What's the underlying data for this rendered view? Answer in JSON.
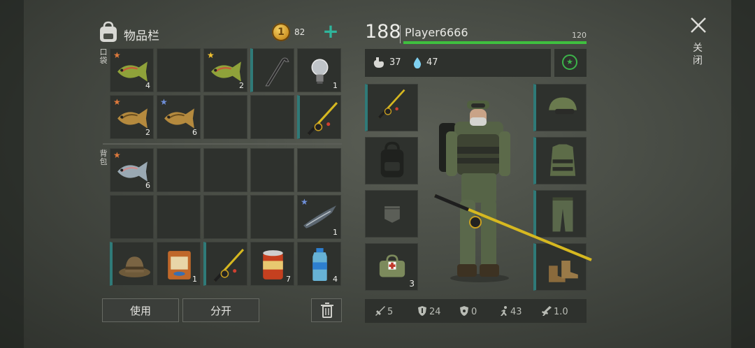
{
  "inventory": {
    "title": "物品栏",
    "coins": "82",
    "pocket_label": "口袋",
    "backpack_label": "背包",
    "pockets": [
      {
        "icon": "perch-fish-icon",
        "count": "4",
        "star": "orange"
      },
      {
        "icon": "empty",
        "count": ""
      },
      {
        "icon": "perch-fish-icon",
        "count": "2",
        "star": "gold"
      },
      {
        "icon": "crowbar-icon",
        "count": "",
        "accent": true
      },
      {
        "icon": "lightbulb-icon",
        "count": "1"
      },
      {
        "icon": "carp-fish-icon",
        "count": "2",
        "star": "orange"
      },
      {
        "icon": "carp-fish-icon",
        "count": "6",
        "star": "blue"
      },
      {
        "icon": "empty",
        "count": ""
      },
      {
        "icon": "empty",
        "count": ""
      },
      {
        "icon": "fishing-rod-icon",
        "count": "",
        "accent": true
      }
    ],
    "backpack": [
      {
        "icon": "salmon-fish-icon",
        "count": "6",
        "star": "orange"
      },
      {
        "icon": "empty",
        "count": ""
      },
      {
        "icon": "empty",
        "count": ""
      },
      {
        "icon": "empty",
        "count": ""
      },
      {
        "icon": "empty",
        "count": ""
      },
      {
        "icon": "empty",
        "count": ""
      },
      {
        "icon": "empty",
        "count": ""
      },
      {
        "icon": "empty",
        "count": ""
      },
      {
        "icon": "empty",
        "count": ""
      },
      {
        "icon": "sturgeon-fish-icon",
        "count": "1",
        "star": "blue"
      },
      {
        "icon": "bucket-hat-icon",
        "count": "",
        "accent": true
      },
      {
        "icon": "bait-bag-icon",
        "count": "1"
      },
      {
        "icon": "fishing-rod-icon",
        "count": "",
        "accent": true
      },
      {
        "icon": "canned-food-icon",
        "count": "7"
      },
      {
        "icon": "water-bottle-icon",
        "count": "4"
      }
    ],
    "use_label": "使用",
    "split_label": "分开"
  },
  "player": {
    "level": "188",
    "name": "Player6666",
    "xp_max": "120",
    "xp_fraction": 1.0,
    "hunger": "37",
    "thirst": "47"
  },
  "equipment": {
    "left": [
      {
        "icon": "fishing-rod-icon",
        "count": "",
        "accent": true
      },
      {
        "icon": "backpack-icon",
        "count": ""
      },
      {
        "icon": "pocket-placeholder-icon",
        "count": ""
      },
      {
        "icon": "first-aid-bag-icon",
        "count": "3"
      }
    ],
    "right": [
      {
        "icon": "military-cap-icon",
        "count": "",
        "accent": true
      },
      {
        "icon": "camo-vest-icon",
        "count": "",
        "accent": true
      },
      {
        "icon": "camo-pants-icon",
        "count": "",
        "accent": true
      },
      {
        "icon": "boots-icon",
        "count": "",
        "accent": true
      }
    ]
  },
  "stats": {
    "attack": "5",
    "defense": "24",
    "radiation": "0",
    "speed": "43",
    "stealth": "1.0"
  },
  "close_label": "关闭",
  "colors": {
    "accent": "#2f7a78",
    "xp": "#3fbf3f",
    "plus": "#2fb59c",
    "star_orange": "#e07a3c",
    "star_gold": "#f2c230",
    "star_blue": "#6f8fd8"
  }
}
